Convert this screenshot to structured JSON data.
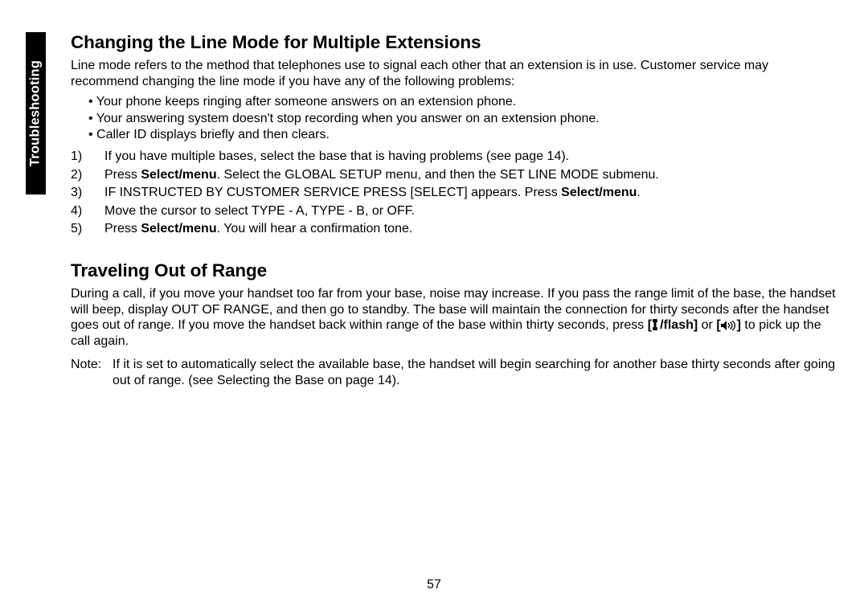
{
  "side_tab": "Troubleshooting",
  "section1": {
    "title": "Changing the Line Mode for Multiple Extensions",
    "intro": "Line mode refers to the method that telephones use to signal each other that an extension is in use. Customer service may recommend changing the line mode if you have any of the following problems:",
    "bullets": [
      "Your phone keeps ringing after someone answers on an extension phone.",
      "Your answering system doesn't stop recording when you answer on an extension phone.",
      "Caller ID displays briefly and then clears."
    ],
    "steps": {
      "s1": "If you have multiple bases, select the base that is having problems (see page 14).",
      "s2a": "Press ",
      "s2b": "Select/menu",
      "s2c": ". Select the GLOBAL SETUP menu, and then the SET LINE MODE submenu.",
      "s3a": "IF INSTRUCTED BY CUSTOMER SERVICE PRESS [SELECT] appears. Press ",
      "s3b": "Select/menu",
      "s3c": ".",
      "s4": "Move the cursor to select TYPE - A, TYPE - B, or OFF.",
      "s5a": "Press ",
      "s5b": "Select/menu",
      "s5c": ". You will hear a confirmation tone."
    }
  },
  "section2": {
    "title": "Traveling Out of Range",
    "para_a": "During a call, if you move your handset too far from your base, noise may increase. If you pass the range limit of the base, the handset will beep, display OUT OF RANGE, and then go to standby. The base will maintain the connection for thirty seconds after the handset goes out of range. If you move the handset back within range of the base within thirty seconds, press ",
    "flash_prefix": "[",
    "flash_suffix": "/flash]",
    "para_b": " or ",
    "speaker_prefix": "[",
    "speaker_suffix": "]",
    "para_c": " to pick up the call again.",
    "note_label": "Note:",
    "note_body": "If it is set to automatically select the available base, the handset will begin searching for another base thirty seconds after going out of range. (see Selecting the Base on page 14)."
  },
  "page_number": "57"
}
